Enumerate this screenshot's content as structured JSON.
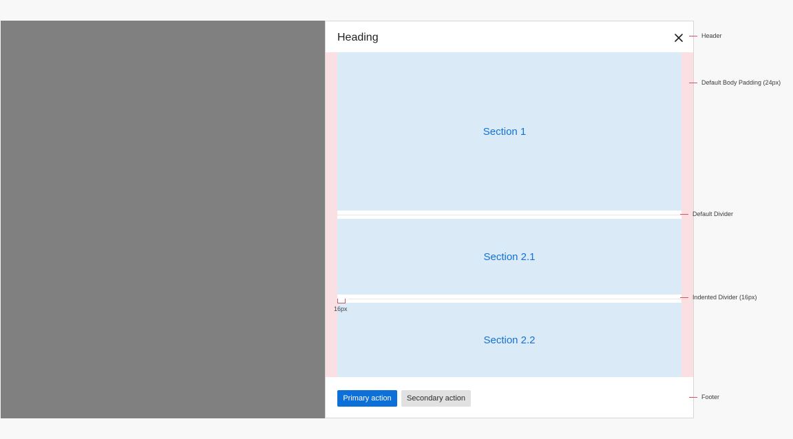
{
  "header": {
    "title": "Heading",
    "close_icon": "close-icon"
  },
  "sections": [
    {
      "label": "Section 1"
    },
    {
      "label": "Section 2.1"
    },
    {
      "label": "Section 2.2"
    }
  ],
  "footer": {
    "primary_label": "Primary action",
    "secondary_label": "Secondary action"
  },
  "measurement": {
    "indent_label": "16px"
  },
  "annotations": {
    "header": "Header",
    "body_padding": "Default Body Padding (24px)",
    "default_divider": "Default Divider",
    "indented_divider": "Indented Divider (16px)",
    "footer": "Footer"
  },
  "colors": {
    "overlay": "#808080",
    "section_fill": "#dbeaf7",
    "section_text": "#1371d5",
    "padding_fill": "#fae0e2",
    "primary_button": "#0d6fd8",
    "secondary_button": "#e1e1e1",
    "annotation_line": "#d9535f"
  }
}
